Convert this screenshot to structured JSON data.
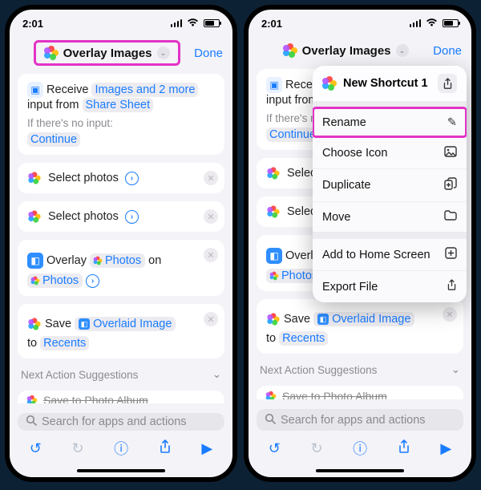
{
  "status": {
    "time": "2:01"
  },
  "header": {
    "title": "Overlay Images",
    "done": "Done"
  },
  "receive": {
    "word_receive": "Receive",
    "link1": "Images and 2 more",
    "word_input_from": "input from",
    "link2": "Share Sheet",
    "no_input_hint": "If there's no input:",
    "continue": "Continue"
  },
  "step_select": "Select photos",
  "overlay": {
    "label": "Overlay",
    "photos": "Photos",
    "on": "on"
  },
  "save": {
    "label": "Save",
    "overlaid": "Overlaid Image",
    "to": "to",
    "recents": "Recents"
  },
  "suggestions": {
    "heading": "Next Action Suggestions",
    "cut": "Save to Photo Album"
  },
  "search": {
    "placeholder": "Search for apps and actions"
  },
  "popover": {
    "title": "New Shortcut 1",
    "items": [
      {
        "label": "Rename",
        "icon": "pencil"
      },
      {
        "label": "Choose Icon",
        "icon": "image"
      },
      {
        "label": "Duplicate",
        "icon": "dup"
      },
      {
        "label": "Move",
        "icon": "folder"
      },
      {
        "label": "Add to Home Screen",
        "icon": "plusbox"
      },
      {
        "label": "Export File",
        "icon": "share"
      }
    ]
  }
}
